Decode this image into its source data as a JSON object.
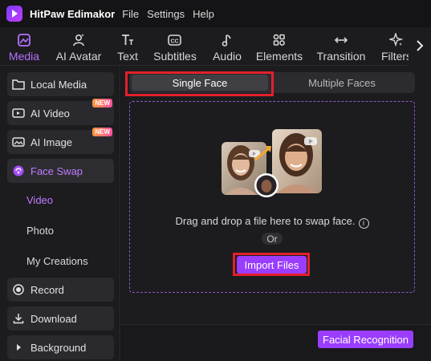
{
  "app": {
    "title": "HitPaw Edimakor"
  },
  "menu": [
    "File",
    "Settings",
    "Help"
  ],
  "toolbar": {
    "items": [
      {
        "label": "Media",
        "icon": "media-icon",
        "active": true
      },
      {
        "label": "AI Avatar",
        "icon": "avatar-icon",
        "active": false
      },
      {
        "label": "Text",
        "icon": "text-icon",
        "active": false
      },
      {
        "label": "Subtitles",
        "icon": "subtitles-icon",
        "active": false
      },
      {
        "label": "Audio",
        "icon": "music-note-icon",
        "active": false
      },
      {
        "label": "Elements",
        "icon": "elements-icon",
        "active": false
      },
      {
        "label": "Transition",
        "icon": "transition-icon",
        "active": false
      },
      {
        "label": "Filters",
        "icon": "sparkle-icon",
        "active": false
      }
    ]
  },
  "sidebar": {
    "items": [
      {
        "label": "Local Media",
        "icon": "folder-icon"
      },
      {
        "label": "AI Video",
        "icon": "video-icon",
        "badge": "NEW"
      },
      {
        "label": "AI Image",
        "icon": "image-icon",
        "badge": "NEW"
      },
      {
        "label": "Face Swap",
        "icon": "face-swap-icon",
        "active": true
      }
    ],
    "sub_items": [
      {
        "label": "Video",
        "active": true
      },
      {
        "label": "Photo",
        "active": false
      },
      {
        "label": "My Creations",
        "active": false
      }
    ],
    "bottom_items": [
      {
        "label": "Record",
        "icon": "record-icon"
      },
      {
        "label": "Download",
        "icon": "download-icon"
      },
      {
        "label": "Background",
        "icon": "chevron-right-icon"
      }
    ]
  },
  "face_swap": {
    "tabs": [
      "Single Face",
      "Multiple Faces"
    ],
    "selected_tab": "Single Face",
    "drop_text": "Drag and drop a file here to swap face.",
    "or_text": "Or",
    "import_label": "Import Files",
    "facial_recognition_label": "Facial Recognition"
  },
  "colors": {
    "accent": "#9a3dff",
    "active_text": "#c07bff",
    "highlight": "#e3202a",
    "background": "#1c1c1f"
  }
}
